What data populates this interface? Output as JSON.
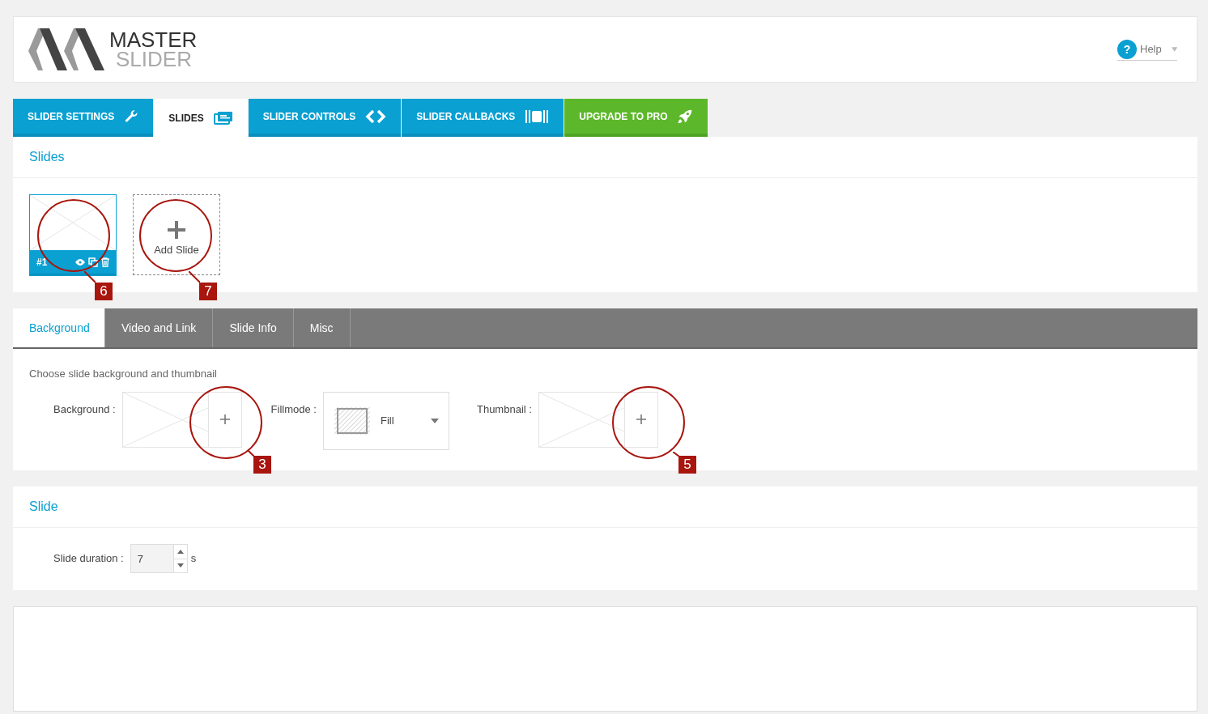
{
  "header": {
    "logo_line_1": "MASTER",
    "logo_line_2": "SLIDER",
    "help_icon": "?",
    "help": "Help"
  },
  "tabs": [
    {
      "label": "SLIDER SETTINGS",
      "selected": false,
      "kind": "settings"
    },
    {
      "label": "SLIDES",
      "selected": true,
      "kind": "slides"
    },
    {
      "label": "SLIDER CONTROLS",
      "selected": false,
      "kind": "controls"
    },
    {
      "label": "SLIDER CALLBACKS",
      "selected": false,
      "kind": "callbacks"
    },
    {
      "label": "UPGRADE TO PRO",
      "selected": false,
      "kind": "upgrade"
    }
  ],
  "slides_panel": {
    "title": "Slides",
    "slides": [
      {
        "label": "#1",
        "selected": true
      }
    ],
    "add_slide": "Add Slide"
  },
  "sub_tabs": [
    {
      "label": "Background",
      "selected": true
    },
    {
      "label": "Video and Link",
      "selected": false
    },
    {
      "label": "Slide Info",
      "selected": false
    },
    {
      "label": "Misc",
      "selected": false
    }
  ],
  "background_panel": {
    "intro": "Choose slide background and thumbnail",
    "background_label": "Background :",
    "fillmode_label": "Fillmode :",
    "fillmode_value": "Fill",
    "thumbnail_label": "Thumbnail :"
  },
  "slide_panel": {
    "title": "Slide",
    "duration_label": "Slide duration :",
    "duration_value": "7",
    "unit": "s"
  },
  "annotations": [
    {
      "label": "6"
    },
    {
      "label": "7"
    },
    {
      "label": "3"
    },
    {
      "label": "5"
    }
  ]
}
